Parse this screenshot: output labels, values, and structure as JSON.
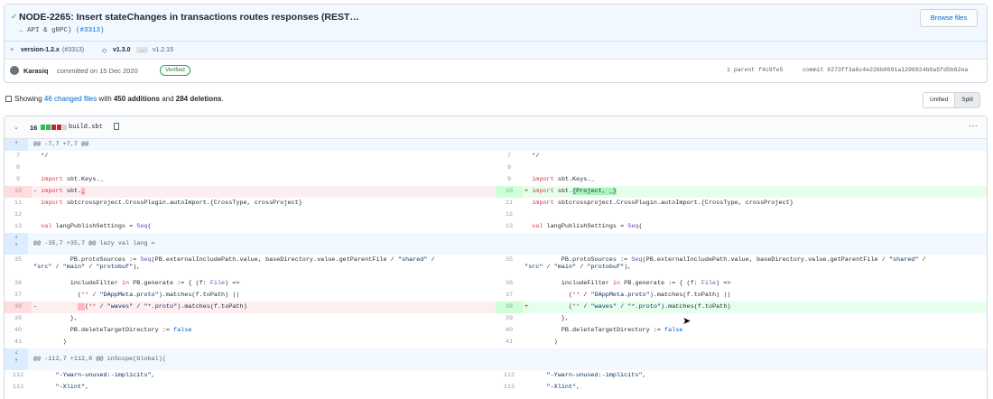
{
  "commit": {
    "title": "NODE-2265: Insert stateChanges in transactions routes responses (REST…",
    "subtitle_text": "… API & gRPC) ",
    "subtitle_pr": "(#3313)",
    "browse_label": "Browse files",
    "branch": "version-1.2.x",
    "branch_pr": "(#3313)",
    "tag_main": "v1.3.0",
    "tag_more": "…",
    "tag_old": "v1.2.15",
    "author": "Karasiq",
    "committed_text": "committed on 15 Dec 2020",
    "verified": "Verified",
    "parent_text": "1 parent f4c9fe5",
    "commit_text": "commit 6273ff3a6c4e226b0691a1296824b9a5fd5b62ea"
  },
  "summary": {
    "prefix": "Showing ",
    "changed": "46 changed files",
    "mid": " with ",
    "additions": "450 additions",
    "and": " and ",
    "deletions": "284 deletions",
    "suffix": "."
  },
  "view": {
    "unified": "Unified",
    "split": "Split"
  },
  "file": {
    "count": "16",
    "name": "build.sbt",
    "more": "···"
  },
  "hunks": {
    "h1": "@@ -7,7 +7,7 @@",
    "h2": "@@ -35,7 +35,7 @@ lazy val lang =",
    "h3": "@@ -112,7 +112,8 @@ inScope(Global)("
  },
  "colors": {
    "accent": "#0366d6",
    "added": "#e6ffed",
    "deleted": "#ffeef0",
    "verified": "#28a745"
  }
}
